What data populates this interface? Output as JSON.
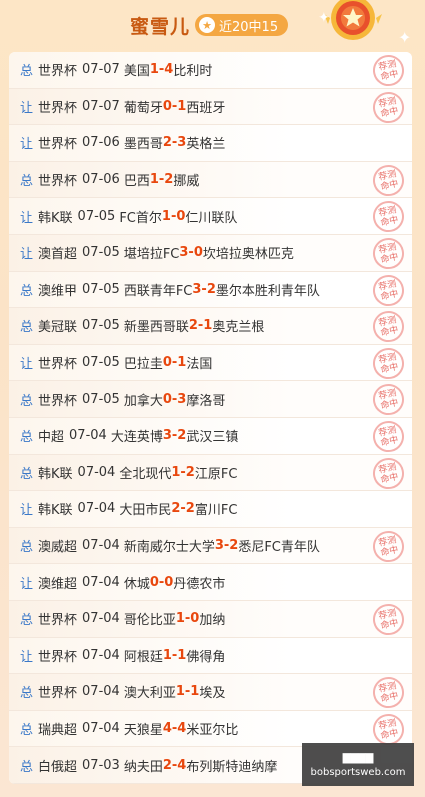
{
  "header": {
    "name": "蜜雪儿",
    "badge": "近20中15"
  },
  "stamp_text": [
    "荐测",
    "命中"
  ],
  "watermark": {
    "line1": "▇▇▇▇",
    "line2": "bobsportsweb.com"
  },
  "rows": [
    {
      "tag": "总",
      "league": "世界杯",
      "date": "07-07",
      "home": "美国",
      "hs": "1",
      "as": "4",
      "away": "比利时",
      "hit": true
    },
    {
      "tag": "让",
      "league": "世界杯",
      "date": "07-07",
      "home": "葡萄牙",
      "hs": "0",
      "as": "1",
      "away": "西班牙",
      "hit": true
    },
    {
      "tag": "让",
      "league": "世界杯",
      "date": "07-06",
      "home": "墨西哥",
      "hs": "2",
      "as": "3",
      "away": "英格兰",
      "hit": false
    },
    {
      "tag": "总",
      "league": "世界杯",
      "date": "07-06",
      "home": "巴西",
      "hs": "1",
      "as": "2",
      "away": "挪威",
      "hit": true
    },
    {
      "tag": "让",
      "league": "韩K联",
      "date": "07-05",
      "home": "FC首尔",
      "hs": "1",
      "as": "0",
      "away": "仁川联队",
      "hit": true
    },
    {
      "tag": "让",
      "league": "澳首超",
      "date": "07-05",
      "home": "堪培拉FC",
      "hs": "3",
      "as": "0",
      "away": "坎培拉奥林匹克",
      "hit": true
    },
    {
      "tag": "总",
      "league": "澳维甲",
      "date": "07-05",
      "home": "西联青年FC",
      "hs": "3",
      "as": "2",
      "away": "墨尔本胜利青年队",
      "hit": true
    },
    {
      "tag": "总",
      "league": "美冠联",
      "date": "07-05",
      "home": "新墨西哥联",
      "hs": "2",
      "as": "1",
      "away": "奥克兰根",
      "hit": true
    },
    {
      "tag": "让",
      "league": "世界杯",
      "date": "07-05",
      "home": "巴拉圭",
      "hs": "0",
      "as": "1",
      "away": "法国",
      "hit": true
    },
    {
      "tag": "总",
      "league": "世界杯",
      "date": "07-05",
      "home": "加拿大",
      "hs": "0",
      "as": "3",
      "away": "摩洛哥",
      "hit": true
    },
    {
      "tag": "总",
      "league": "中超",
      "date": "07-04",
      "home": "大连英博",
      "hs": "3",
      "as": "2",
      "away": "武汉三镇",
      "hit": true
    },
    {
      "tag": "总",
      "league": "韩K联",
      "date": "07-04",
      "home": "全北现代",
      "hs": "1",
      "as": "2",
      "away": "江原FC",
      "hit": true
    },
    {
      "tag": "让",
      "league": "韩K联",
      "date": "07-04",
      "home": "大田市民",
      "hs": "2",
      "as": "2",
      "away": "富川FC",
      "hit": false
    },
    {
      "tag": "总",
      "league": "澳威超",
      "date": "07-04",
      "home": "新南威尔士大学",
      "hs": "3",
      "as": "2",
      "away": "悉尼FC青年队",
      "hit": true
    },
    {
      "tag": "让",
      "league": "澳维超",
      "date": "07-04",
      "home": "休城",
      "hs": "0",
      "as": "0",
      "away": "丹德农市",
      "hit": false
    },
    {
      "tag": "总",
      "league": "世界杯",
      "date": "07-04",
      "home": "哥伦比亚",
      "hs": "1",
      "as": "0",
      "away": "加纳",
      "hit": true
    },
    {
      "tag": "让",
      "league": "世界杯",
      "date": "07-04",
      "home": "阿根廷",
      "hs": "1",
      "as": "1",
      "away": "佛得角",
      "hit": false
    },
    {
      "tag": "总",
      "league": "世界杯",
      "date": "07-04",
      "home": "澳大利亚",
      "hs": "1",
      "as": "1",
      "away": "埃及",
      "hit": true
    },
    {
      "tag": "总",
      "league": "瑞典超",
      "date": "07-04",
      "home": "天狼星",
      "hs": "4",
      "as": "4",
      "away": "米亚尔比",
      "hit": true
    },
    {
      "tag": "总",
      "league": "白俄超",
      "date": "07-03",
      "home": "纳夫田",
      "hs": "2",
      "as": "4",
      "away": "布列斯特迪纳摩",
      "hit": false
    }
  ]
}
